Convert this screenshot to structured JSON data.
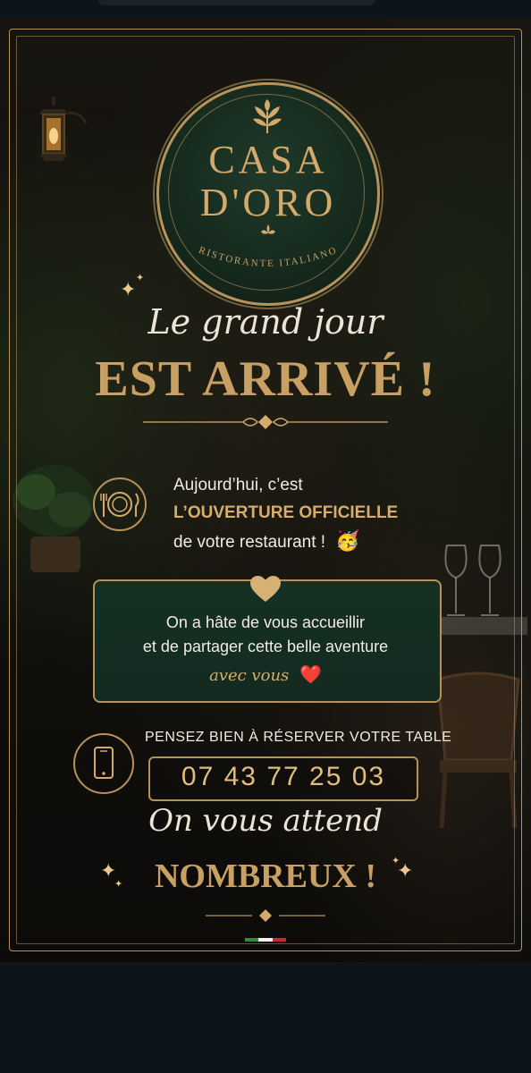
{
  "poster": {
    "logo": {
      "line1": "CASA",
      "line2": "D'ORO",
      "subtitle": "RISTORANTE ITALIANO"
    },
    "script_heading": "Le grand jour",
    "headline": "EST ARRIVÉ !",
    "intro": {
      "line1": "Aujourd’hui, c’est",
      "line2": "L’OUVERTURE OFFICIELLE",
      "line3": "de votre restaurant !",
      "emoji": "🥳"
    },
    "panel": {
      "line1": "On a hâte de vous accueillir",
      "line2": "et de partager cette belle aventure",
      "script": "avec vous",
      "emoji": "❤️"
    },
    "reservation": {
      "label": "PENSEZ BIEN À RÉSERVER VOTRE TABLE",
      "phone": "07 43 77 25 03"
    },
    "closing": {
      "script": "On vous attend",
      "headline": "NOMBREUX !"
    },
    "icons": {
      "logo": "olive-leaf-icon",
      "plate": "plate-cutlery-icon",
      "heart": "heart-icon",
      "phone": "smartphone-icon",
      "sparkle": "sparkle-icon"
    },
    "colors": {
      "gold": "#c9a063",
      "dark_green": "#163024",
      "background": "#0d141c",
      "flag_green": "#2e8b3a",
      "flag_white": "#f2f2f2",
      "flag_red": "#c8282e"
    }
  }
}
